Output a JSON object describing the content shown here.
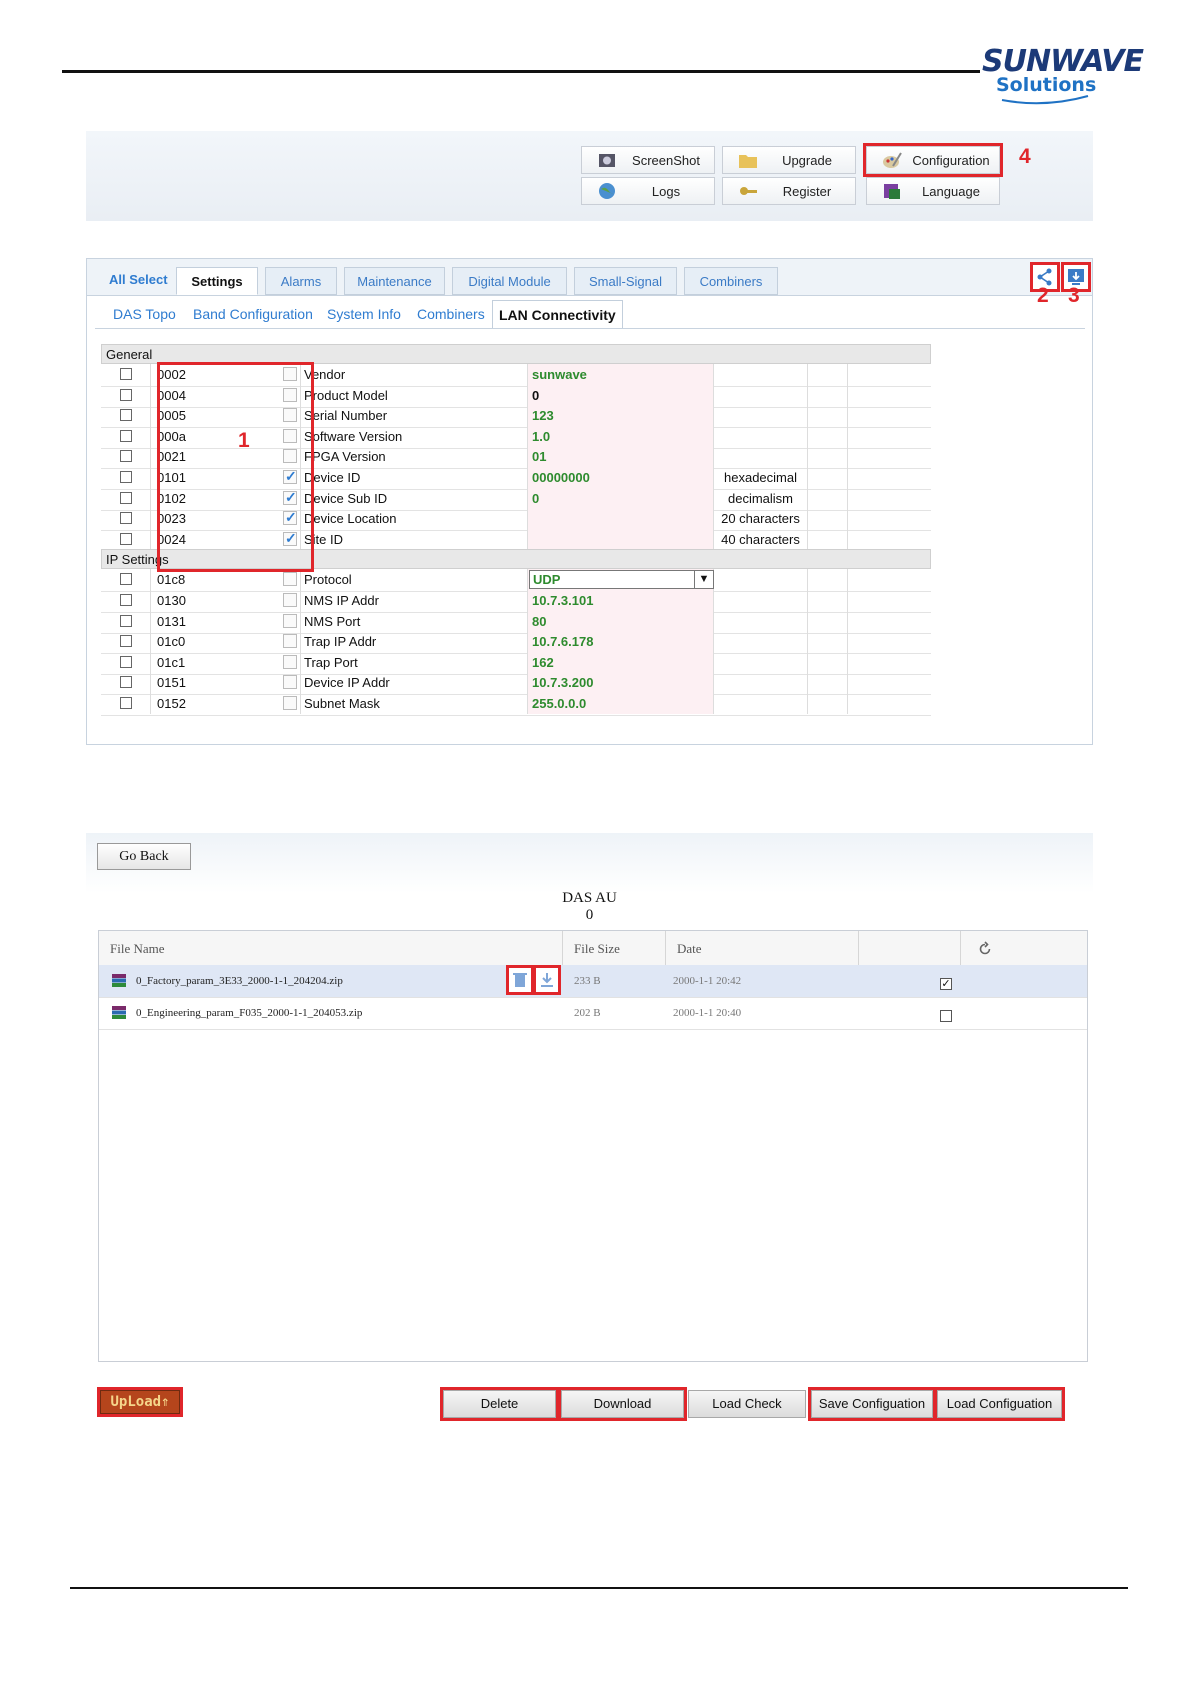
{
  "brand": {
    "logo_line1": "SUNWAVE",
    "logo_line2": "Solutions"
  },
  "toolbar": {
    "buttons": [
      {
        "label": "ScreenShot",
        "icon": "camera-icon"
      },
      {
        "label": "Upgrade",
        "icon": "folder-icon"
      },
      {
        "label": "Configuration",
        "icon": "paint-palette-icon"
      },
      {
        "label": "Logs",
        "icon": "globe-icon"
      },
      {
        "label": "Register",
        "icon": "key-icon"
      },
      {
        "label": "Language",
        "icon": "language-icon"
      }
    ]
  },
  "callouts": [
    "1",
    "2",
    "3",
    "4"
  ],
  "settings": {
    "all_select": "All Select",
    "tabs": [
      "Settings",
      "Alarms",
      "Maintenance",
      "Digital Module",
      "Small-Signal",
      "Combiners"
    ],
    "active_tab": "Settings",
    "subtabs": [
      "DAS Topo",
      "Band Configuration",
      "System Info",
      "Combiners",
      "LAN Connectivity"
    ],
    "active_subtab": "LAN Connectivity",
    "groups": [
      {
        "name": "General",
        "rows": [
          {
            "id": "0002",
            "checked": false,
            "name": "Vendor",
            "value": "sunwave",
            "note": ""
          },
          {
            "id": "0004",
            "checked": false,
            "name": "Product Model",
            "value": "0",
            "note": ""
          },
          {
            "id": "0005",
            "checked": false,
            "name": "Serial Number",
            "value": "123",
            "note": ""
          },
          {
            "id": "000a",
            "checked": false,
            "name": "Software Version",
            "value": "1.0",
            "note": ""
          },
          {
            "id": "0021",
            "checked": false,
            "name": "FPGA Version",
            "value": "01",
            "note": ""
          },
          {
            "id": "0101",
            "checked": true,
            "name": "Device ID",
            "value": "00000000",
            "note": "hexadecimal"
          },
          {
            "id": "0102",
            "checked": true,
            "name": "Device Sub ID",
            "value": "0",
            "note": "decimalism"
          },
          {
            "id": "0023",
            "checked": true,
            "name": "Device Location",
            "value": "",
            "note": "20 characters"
          },
          {
            "id": "0024",
            "checked": true,
            "name": "Site ID",
            "value": "",
            "note": "40 characters"
          }
        ]
      },
      {
        "name": "IP Settings",
        "rows": [
          {
            "id": "01c8",
            "checked": false,
            "name": "Protocol",
            "value": "UDP",
            "note": ""
          },
          {
            "id": "0130",
            "checked": false,
            "name": "NMS IP Addr",
            "value": "10.7.3.101",
            "note": ""
          },
          {
            "id": "0131",
            "checked": false,
            "name": "NMS Port",
            "value": "80",
            "note": ""
          },
          {
            "id": "01c0",
            "checked": false,
            "name": "Trap IP Addr",
            "value": "10.7.6.178",
            "note": ""
          },
          {
            "id": "01c1",
            "checked": false,
            "name": "Trap Port",
            "value": "162",
            "note": ""
          },
          {
            "id": "0151",
            "checked": false,
            "name": "Device IP Addr",
            "value": "10.7.3.200",
            "note": ""
          },
          {
            "id": "0152",
            "checked": false,
            "name": "Subnet Mask",
            "value": "255.0.0.0",
            "note": ""
          }
        ]
      }
    ]
  },
  "files": {
    "go_back": "Go Back",
    "title": "DAS AU",
    "subtitle": "0",
    "columns": [
      "File Name",
      "File Size",
      "Date"
    ],
    "rows": [
      {
        "name": "0_Factory_param_3E33_2000-1-1_204204.zip",
        "size": "233 B",
        "date": "2000-1-1 20:42",
        "checked": "✓"
      },
      {
        "name": "0_Engineering_param_F035_2000-1-1_204053.zip",
        "size": "202 B",
        "date": "2000-1-1 20:40",
        "checked": ""
      }
    ],
    "upload": "UpLoad⇑",
    "buttons": [
      "Delete",
      "Download",
      "Load Check",
      "Save Configuation",
      "Load Configuation"
    ]
  }
}
